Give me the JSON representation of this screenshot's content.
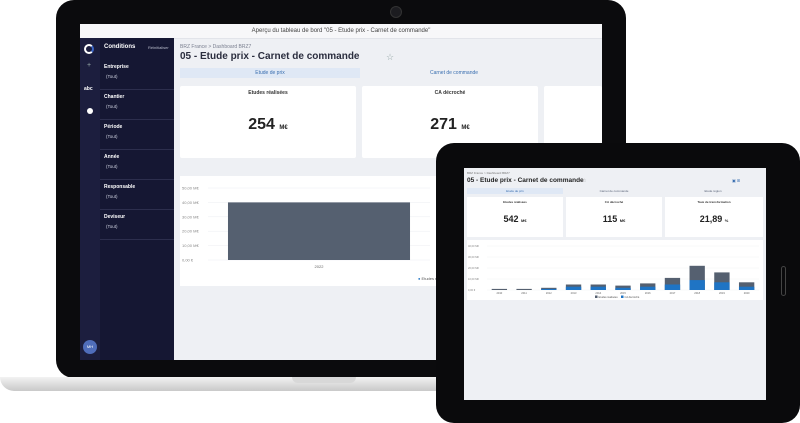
{
  "laptop": {
    "window_title": "Aperçu du tableau de bord \"05 - Etude prix - Carnet de commande\"",
    "sidebar": {
      "conditions_title": "Conditions",
      "reset_label": "Réinitialiser",
      "abc_label": "abc",
      "avatar_label": "MH",
      "filters": [
        {
          "label": "Entreprise",
          "value": "(Tout)"
        },
        {
          "label": "Chantier",
          "value": "(Tout)"
        },
        {
          "label": "Période",
          "value": "(Tout)"
        },
        {
          "label": "Année",
          "value": "(Tout)"
        },
        {
          "label": "Responsable",
          "value": "(Tout)"
        },
        {
          "label": "Deviseur",
          "value": "(Tout)"
        }
      ]
    },
    "breadcrumb": "BRZ France  >  Dashboard BRZ7",
    "title": "05 - Etude prix - Carnet de commande",
    "tabs": [
      "Etude de prix",
      "Carnet de commande"
    ],
    "kpis": [
      {
        "title": "Etudes réalisées",
        "value": "254",
        "unit": "M€"
      },
      {
        "title": "CA décroché",
        "value": "271",
        "unit": "M€"
      }
    ],
    "chart_data": {
      "type": "bar",
      "categories": [
        "2022"
      ],
      "series": [
        {
          "name": "Etudes r...",
          "values": [
            40
          ]
        }
      ],
      "yticks": [
        "50,00 M€",
        "40,00 M€",
        "30,00 M€",
        "20,00 M€",
        "10,00 M€",
        "0,00 €"
      ],
      "ylim": [
        0,
        50
      ],
      "legend_position": "bottom-right",
      "bar_color": "#556070"
    }
  },
  "tablet": {
    "breadcrumb": "BRZ France  >  Dashboard BRZ7",
    "title": "05 - Etude prix - Carnet de commande",
    "tabs": [
      "Etude de prix",
      "Carnet de commande",
      "Etude région"
    ],
    "kpis": [
      {
        "title": "Etudes réalisées",
        "value": "542",
        "unit": "M€"
      },
      {
        "title": "CA décroché",
        "value": "115",
        "unit": "M€"
      },
      {
        "title": "Taux de transformation",
        "value": "21,89",
        "unit": "%"
      }
    ],
    "chart_data": {
      "type": "bar",
      "categories": [
        "2010",
        "2011",
        "2012",
        "2013",
        "2014",
        "2015",
        "2016",
        "2017",
        "2018",
        "2019",
        "2020"
      ],
      "series": [
        {
          "name": "Etudes réalisées",
          "values": [
            1,
            1,
            2,
            5,
            5,
            4,
            6,
            11,
            22,
            16,
            7
          ]
        },
        {
          "name": "CA décroché",
          "values": [
            0,
            0,
            1,
            3,
            3,
            2,
            3,
            5,
            9,
            7,
            3
          ]
        }
      ],
      "yticks": [
        "40,00 M€",
        "30,00 M€",
        "20,00 M€",
        "10,00 M€",
        "0,00 €"
      ],
      "ylim": [
        0,
        40
      ],
      "legend_position": "bottom",
      "colors": [
        "#556070",
        "#1f74c4"
      ]
    }
  }
}
